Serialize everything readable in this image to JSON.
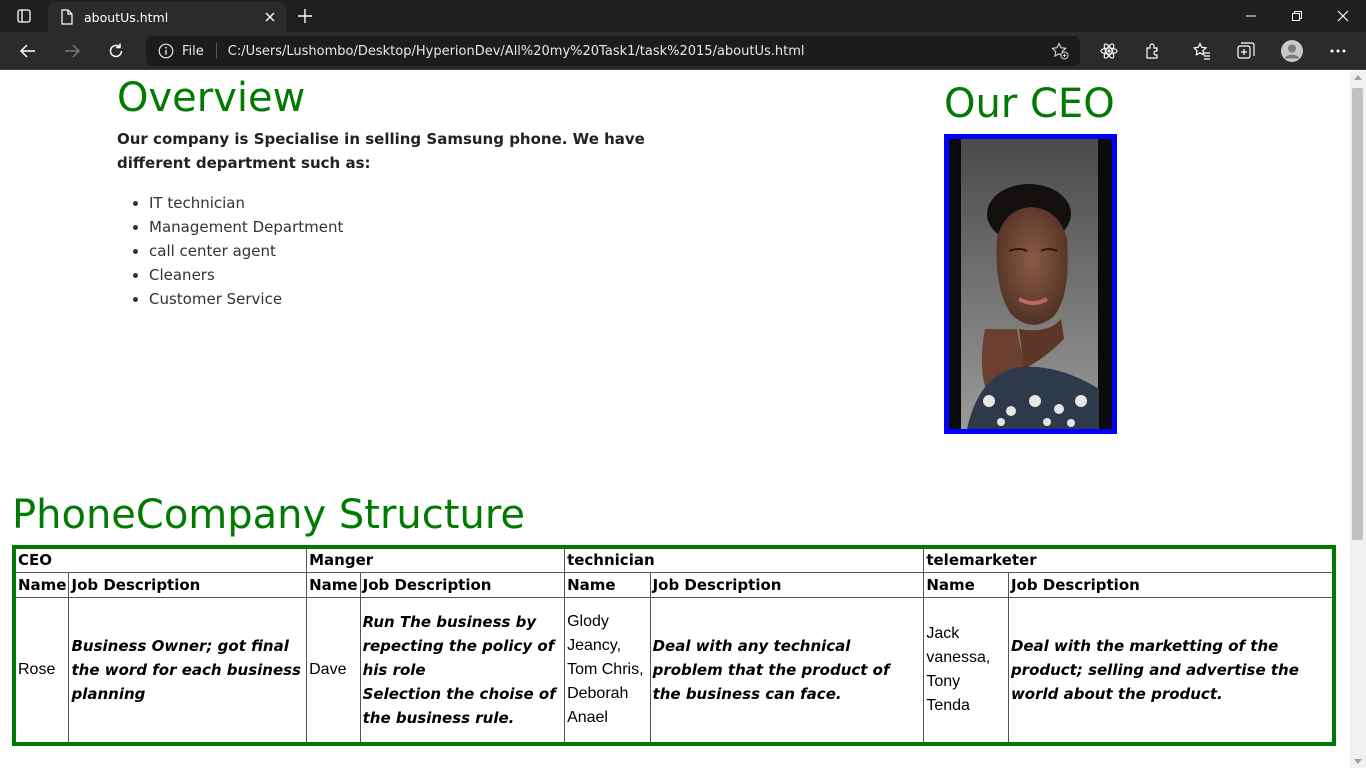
{
  "browser": {
    "tab_title": "aboutUs.html",
    "address_scheme": "File",
    "address_url": "C:/Users/Lushombo/Desktop/HyperionDev/All%20my%20Task1/task%2015/aboutUs.html"
  },
  "overview": {
    "title": "Overview",
    "intro": "Our company is Specialise in selling Samsung phone. We have different department such as:",
    "departments": [
      "IT technician",
      "Management Department",
      "call center agent",
      "Cleaners",
      "Customer Service"
    ]
  },
  "ceo": {
    "title": "Our CEO",
    "photo_border_color": "#0000ff"
  },
  "structure": {
    "title": "PhoneCompany Structure",
    "border_color": "#007a00",
    "groups": [
      {
        "label": "CEO",
        "name_header": "Name",
        "desc_header": "Job Description",
        "names": "Rose",
        "description": [
          "Business Owner; got final the word for each business planning"
        ]
      },
      {
        "label": "Manger",
        "name_header": "Name",
        "desc_header": "Job Description",
        "names": "Dave",
        "description": [
          "Run The business by repecting the policy of his role",
          "Selection the choise of the business rule."
        ]
      },
      {
        "label": "technician",
        "name_header": "Name",
        "desc_header": "Job Description",
        "names": "Glody Jeancy, Tom Chris, Deborah Anael",
        "description": [
          "Deal with any technical problem that the product of the business can face."
        ]
      },
      {
        "label": "telemarketer",
        "name_header": "Name",
        "desc_header": "Job Description",
        "names": "Jack vanessa, Tony Tenda",
        "description": [
          "Deal with the marketting of the product; selling and advertise the world about the product."
        ]
      }
    ]
  },
  "colors": {
    "heading": "#007a00",
    "chrome_dark": "#1f1f1f",
    "toolbar": "#2b2b2b"
  }
}
